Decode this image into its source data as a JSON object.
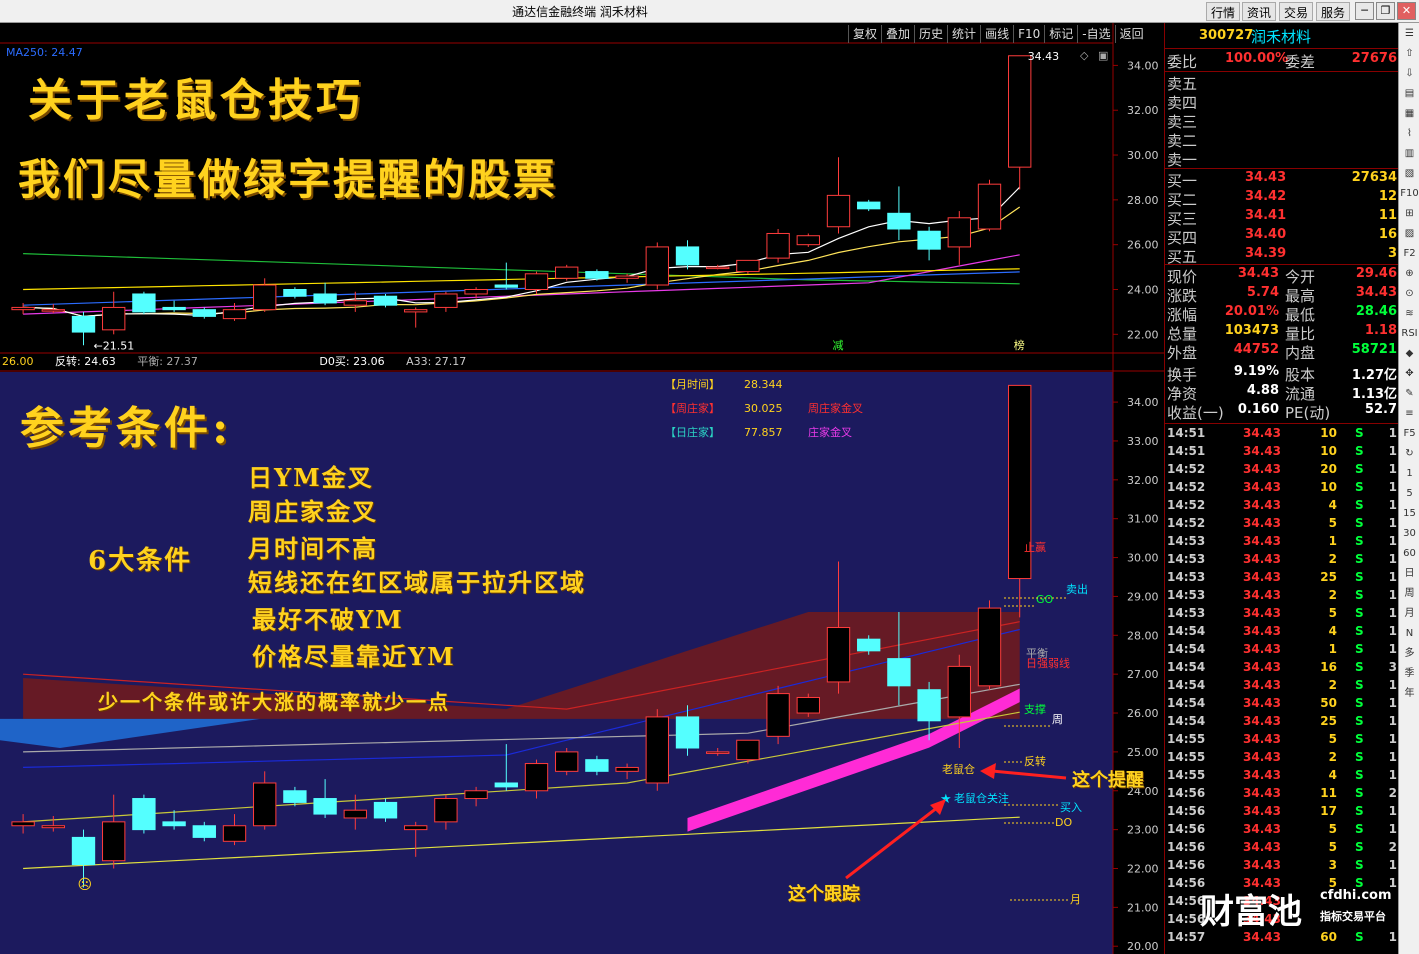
{
  "window": {
    "title": "通达信金融终端  润禾材料"
  },
  "topnav": [
    "行情",
    "资讯",
    "交易",
    "服务"
  ],
  "window_controls": [
    "─",
    "❐",
    "✕"
  ],
  "toolbar": [
    "复权",
    "叠加",
    "历史",
    "统计",
    "画线",
    "F10",
    "标记",
    "-自选",
    "返回"
  ],
  "upper": {
    "ma_label": "MA250: 24.47",
    "headline1": "关于老鼠仓技巧",
    "headline2": "我们尽量做绿字提醒的股票",
    "high_label": "34.43",
    "low_label": "21.51",
    "markers": [
      "减",
      "榜"
    ],
    "y_ticks": [
      "34.00",
      "32.00",
      "30.00",
      "28.00",
      "26.00",
      "24.00",
      "22.00"
    ]
  },
  "lower_header": [
    {
      "text": "26.00",
      "color": "#ffd21e"
    },
    {
      "text": "反转: 24.63",
      "color": "#ffffff"
    },
    {
      "text": "平衡: 27.37",
      "color": "#aaaaaa"
    },
    {
      "text": "D0买: 23.06",
      "color": "#ffffff"
    },
    {
      "text": "A33: 27.17",
      "color": "#cccccc"
    }
  ],
  "lower": {
    "title": "参考条件:",
    "six_label": "6大条件",
    "conditions": [
      "日YM金叉",
      "周庄家金叉",
      "月时间不高",
      "短线还在红区域属于拉升区域",
      "最好不破YM",
      "价格尽量靠近YM"
    ],
    "footnote": "少一个条件或许大涨的概率就少一点",
    "info": [
      {
        "label": "【月时间】",
        "value": "28.344",
        "note": "",
        "color": "#ffd21e"
      },
      {
        "label": "【周庄家】",
        "value": "30.025",
        "note": "周庄家金叉",
        "color": "#ff3030"
      },
      {
        "label": "【日庄家】",
        "value": "77.857",
        "note": "庄家金叉",
        "color": "#2bd4c4"
      }
    ],
    "line_labels": [
      "止赢",
      "卖出",
      "GO",
      "平衡",
      "日强弱线",
      "支撑",
      "周",
      "反转",
      "老鼠仓",
      "老鼠仓关注",
      "买入",
      "DO",
      "月"
    ],
    "annot_remind": "这个提醒",
    "annot_track": "这个跟踪",
    "y_ticks": [
      "34.00",
      "33.00",
      "32.00",
      "31.00",
      "30.00",
      "29.00",
      "28.00",
      "27.00",
      "26.00",
      "25.00",
      "24.00",
      "23.00",
      "22.00",
      "21.00",
      "20.00"
    ]
  },
  "quote": {
    "code": "300727",
    "name": "润禾材料",
    "weibi_label": "委比",
    "weibi": "100.00%",
    "weicha_label": "委差",
    "weicha": "27676",
    "asks": [
      {
        "label": "卖五",
        "price": "",
        "vol": ""
      },
      {
        "label": "卖四",
        "price": "",
        "vol": ""
      },
      {
        "label": "卖三",
        "price": "",
        "vol": ""
      },
      {
        "label": "卖二",
        "price": "",
        "vol": ""
      },
      {
        "label": "卖一",
        "price": "",
        "vol": ""
      }
    ],
    "bids": [
      {
        "label": "买一",
        "price": "34.43",
        "vol": "27634"
      },
      {
        "label": "买二",
        "price": "34.42",
        "vol": "12"
      },
      {
        "label": "买三",
        "price": "34.41",
        "vol": "11"
      },
      {
        "label": "买四",
        "price": "34.40",
        "vol": "16"
      },
      {
        "label": "买五",
        "price": "34.39",
        "vol": "3"
      }
    ],
    "stats": [
      {
        "l1": "现价",
        "v1": "34.43",
        "c1": "#ff3030",
        "l2": "今开",
        "v2": "29.46",
        "c2": "#ff3030"
      },
      {
        "l1": "涨跌",
        "v1": "5.74",
        "c1": "#ff3030",
        "l2": "最高",
        "v2": "34.43",
        "c2": "#ff3030"
      },
      {
        "l1": "涨幅",
        "v1": "20.01%",
        "c1": "#ff3030",
        "l2": "最低",
        "v2": "28.46",
        "c2": "#00ff3a"
      },
      {
        "l1": "总量",
        "v1": "103473",
        "c1": "#ffd21e",
        "l2": "量比",
        "v2": "1.18",
        "c2": "#ff3030"
      },
      {
        "l1": "外盘",
        "v1": "44752",
        "c1": "#ff3030",
        "l2": "内盘",
        "v2": "58721",
        "c2": "#00ff3a"
      },
      {
        "l1": "换手",
        "v1": "9.19%",
        "c1": "#ffffff",
        "l2": "股本",
        "v2": "1.27亿",
        "c2": "#ffffff"
      },
      {
        "l1": "净资",
        "v1": "4.88",
        "c1": "#ffffff",
        "l2": "流通",
        "v2": "1.13亿",
        "c2": "#ffffff"
      },
      {
        "l1": "收益(一)",
        "v1": "0.160",
        "c1": "#ffffff",
        "l2": "PE(动)",
        "v2": "52.7",
        "c2": "#ffffff"
      }
    ],
    "ticks": [
      {
        "t": "14:51",
        "p": "34.43",
        "v": "10",
        "s": "S",
        "n": "1"
      },
      {
        "t": "14:51",
        "p": "34.43",
        "v": "10",
        "s": "S",
        "n": "1"
      },
      {
        "t": "14:52",
        "p": "34.43",
        "v": "20",
        "s": "S",
        "n": "1"
      },
      {
        "t": "14:52",
        "p": "34.43",
        "v": "10",
        "s": "S",
        "n": "1"
      },
      {
        "t": "14:52",
        "p": "34.43",
        "v": "4",
        "s": "S",
        "n": "1"
      },
      {
        "t": "14:52",
        "p": "34.43",
        "v": "5",
        "s": "S",
        "n": "1"
      },
      {
        "t": "14:53",
        "p": "34.43",
        "v": "1",
        "s": "S",
        "n": "1"
      },
      {
        "t": "14:53",
        "p": "34.43",
        "v": "2",
        "s": "S",
        "n": "1"
      },
      {
        "t": "14:53",
        "p": "34.43",
        "v": "25",
        "s": "S",
        "n": "1"
      },
      {
        "t": "14:53",
        "p": "34.43",
        "v": "2",
        "s": "S",
        "n": "1"
      },
      {
        "t": "14:53",
        "p": "34.43",
        "v": "5",
        "s": "S",
        "n": "1"
      },
      {
        "t": "14:54",
        "p": "34.43",
        "v": "4",
        "s": "S",
        "n": "1"
      },
      {
        "t": "14:54",
        "p": "34.43",
        "v": "1",
        "s": "S",
        "n": "1"
      },
      {
        "t": "14:54",
        "p": "34.43",
        "v": "16",
        "s": "S",
        "n": "3"
      },
      {
        "t": "14:54",
        "p": "34.43",
        "v": "2",
        "s": "S",
        "n": "1"
      },
      {
        "t": "14:54",
        "p": "34.43",
        "v": "50",
        "s": "S",
        "n": "1"
      },
      {
        "t": "14:54",
        "p": "34.43",
        "v": "25",
        "s": "S",
        "n": "1"
      },
      {
        "t": "14:55",
        "p": "34.43",
        "v": "5",
        "s": "S",
        "n": "1"
      },
      {
        "t": "14:55",
        "p": "34.43",
        "v": "2",
        "s": "S",
        "n": "1"
      },
      {
        "t": "14:55",
        "p": "34.43",
        "v": "4",
        "s": "S",
        "n": "1"
      },
      {
        "t": "14:56",
        "p": "34.43",
        "v": "11",
        "s": "S",
        "n": "2"
      },
      {
        "t": "14:56",
        "p": "34.43",
        "v": "17",
        "s": "S",
        "n": "1"
      },
      {
        "t": "14:56",
        "p": "34.43",
        "v": "5",
        "s": "S",
        "n": "1"
      },
      {
        "t": "14:56",
        "p": "34.43",
        "v": "5",
        "s": "S",
        "n": "2"
      },
      {
        "t": "14:56",
        "p": "34.43",
        "v": "3",
        "s": "S",
        "n": "1"
      },
      {
        "t": "14:56",
        "p": "34.43",
        "v": "5",
        "s": "S",
        "n": "1"
      },
      {
        "t": "14:56",
        "p": "34.43",
        "v": "",
        "s": "",
        "n": ""
      },
      {
        "t": "14:56",
        "p": "34.43",
        "v": "",
        "s": "",
        "n": ""
      },
      {
        "t": "14:57",
        "p": "34.43",
        "v": "60",
        "s": "S",
        "n": "1"
      }
    ]
  },
  "right_tools": [
    "☰",
    "⇧",
    "⇩",
    "▤",
    "▦",
    "⌇",
    "▥",
    "▧",
    "F10",
    "⊞",
    "▨",
    "F2",
    "⊕",
    "⊙",
    "≋",
    "RSI",
    "◆",
    "✥",
    "✎",
    "≡",
    "F5",
    "↻",
    "1",
    "5",
    "15",
    "30",
    "60",
    "日",
    "周",
    "月",
    "N",
    "多",
    "季",
    "年"
  ],
  "logo": {
    "main": "财富池",
    "domain": "cfdhi.com",
    "sub": "指标交易平台"
  },
  "candles": [
    {
      "o": 23.1,
      "h": 23.4,
      "l": 22.9,
      "c": 23.2
    },
    {
      "o": 23.05,
      "h": 23.35,
      "l": 22.95,
      "c": 23.1
    },
    {
      "o": 22.8,
      "h": 23.0,
      "l": 21.51,
      "c": 22.1
    },
    {
      "o": 22.2,
      "h": 23.9,
      "l": 22.0,
      "c": 23.2
    },
    {
      "o": 23.8,
      "h": 23.9,
      "l": 22.9,
      "c": 23.0
    },
    {
      "o": 23.2,
      "h": 23.5,
      "l": 23.0,
      "c": 23.1
    },
    {
      "o": 23.1,
      "h": 23.2,
      "l": 22.7,
      "c": 22.8
    },
    {
      "o": 22.7,
      "h": 23.4,
      "l": 22.6,
      "c": 23.1
    },
    {
      "o": 23.1,
      "h": 24.5,
      "l": 23.0,
      "c": 24.2
    },
    {
      "o": 24.0,
      "h": 24.1,
      "l": 23.6,
      "c": 23.7
    },
    {
      "o": 23.8,
      "h": 24.3,
      "l": 23.3,
      "c": 23.4
    },
    {
      "o": 23.3,
      "h": 23.9,
      "l": 23.0,
      "c": 23.5
    },
    {
      "o": 23.7,
      "h": 23.8,
      "l": 23.2,
      "c": 23.3
    },
    {
      "o": 23.0,
      "h": 23.2,
      "l": 22.3,
      "c": 23.1
    },
    {
      "o": 23.2,
      "h": 23.9,
      "l": 23.0,
      "c": 23.8
    },
    {
      "o": 23.8,
      "h": 24.1,
      "l": 23.6,
      "c": 24.0
    },
    {
      "o": 24.2,
      "h": 25.2,
      "l": 24.0,
      "c": 24.1
    },
    {
      "o": 24.0,
      "h": 24.8,
      "l": 23.8,
      "c": 24.7
    },
    {
      "o": 24.5,
      "h": 25.1,
      "l": 24.4,
      "c": 25.0
    },
    {
      "o": 24.8,
      "h": 24.9,
      "l": 24.4,
      "c": 24.5
    },
    {
      "o": 24.5,
      "h": 24.7,
      "l": 24.3,
      "c": 24.6
    },
    {
      "o": 24.2,
      "h": 26.1,
      "l": 24.0,
      "c": 25.9
    },
    {
      "o": 25.9,
      "h": 26.2,
      "l": 24.9,
      "c": 25.1
    },
    {
      "o": 25.0,
      "h": 25.1,
      "l": 24.9,
      "c": 25.0
    },
    {
      "o": 24.8,
      "h": 25.3,
      "l": 24.7,
      "c": 25.3
    },
    {
      "o": 25.4,
      "h": 26.7,
      "l": 25.2,
      "c": 26.5
    },
    {
      "o": 26.0,
      "h": 26.5,
      "l": 25.9,
      "c": 26.4
    },
    {
      "o": 26.8,
      "h": 29.9,
      "l": 26.5,
      "c": 28.2
    },
    {
      "o": 27.9,
      "h": 28.0,
      "l": 27.5,
      "c": 27.6
    },
    {
      "o": 27.4,
      "h": 28.6,
      "l": 26.2,
      "c": 26.7
    },
    {
      "o": 26.6,
      "h": 26.8,
      "l": 25.3,
      "c": 25.8
    },
    {
      "o": 25.9,
      "h": 27.5,
      "l": 25.1,
      "c": 27.2
    },
    {
      "o": 26.7,
      "h": 28.9,
      "l": 26.6,
      "c": 28.7
    },
    {
      "o": 29.46,
      "h": 34.43,
      "l": 28.46,
      "c": 34.43
    }
  ]
}
